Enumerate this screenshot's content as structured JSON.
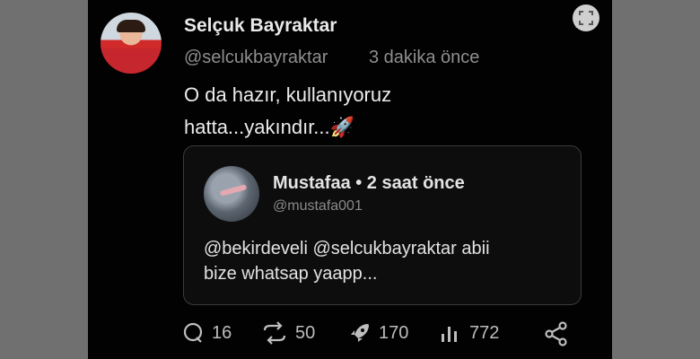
{
  "post": {
    "author_name": "Selçuk Bayraktar",
    "author_handle": "@selcukbayraktar",
    "time": "3 dakika önce",
    "text_line1": "O da hazır, kullanıyoruz",
    "text_line2": "hatta...yakındır...",
    "text_emoji": "🚀"
  },
  "quote": {
    "author_line": "Mustafaa • 2 saat önce",
    "handle": "@mustafa001",
    "text_line1": "@bekirdeveli @selcukbayraktar  abii",
    "text_line2": "bize whatsap yaapp..."
  },
  "actions": {
    "replies": "16",
    "reposts": "50",
    "boosts": "170",
    "views": "772"
  },
  "icons": [
    "expand-icon",
    "more-icon",
    "reply-icon",
    "repost-icon",
    "rocket-icon",
    "views-icon",
    "share-icon"
  ],
  "colors": {
    "background": "#020202",
    "text": "#e8e8e8",
    "muted": "#8e8e8e",
    "quote_border": "#3b3b3b"
  }
}
